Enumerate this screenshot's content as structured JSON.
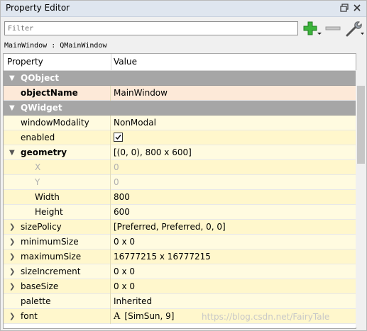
{
  "window": {
    "title": "Property Editor",
    "float_icon": "float-icon",
    "close_icon": "close-icon"
  },
  "toolbar": {
    "filter_placeholder": "Filter",
    "add_icon": "plus-icon",
    "remove_icon": "minus-icon",
    "configure_icon": "wrench-icon"
  },
  "object_label": "MainWindow : QMainWindow",
  "table": {
    "header_property": "Property",
    "header_value": "Value"
  },
  "rows": [
    {
      "type": "category",
      "name": "QObject"
    },
    {
      "type": "prop",
      "name": "objectName",
      "value": "MainWindow",
      "bold": true,
      "selected": true
    },
    {
      "type": "category",
      "name": "QWidget"
    },
    {
      "type": "prop",
      "name": "windowModality",
      "value": "NonModal"
    },
    {
      "type": "prop",
      "name": "enabled",
      "value": "",
      "checked": true
    },
    {
      "type": "prop",
      "name": "geometry",
      "value": "[(0, 0), 800 x 600]",
      "bold": true,
      "expanded": true
    },
    {
      "type": "sub",
      "name": "X",
      "value": "0",
      "dim": true
    },
    {
      "type": "sub",
      "name": "Y",
      "value": "0",
      "dim": true
    },
    {
      "type": "sub",
      "name": "Width",
      "value": "800"
    },
    {
      "type": "sub",
      "name": "Height",
      "value": "600"
    },
    {
      "type": "prop",
      "name": "sizePolicy",
      "value": "[Preferred, Preferred, 0, 0]",
      "collapsed": true
    },
    {
      "type": "prop",
      "name": "minimumSize",
      "value": "0 x 0",
      "collapsed": true
    },
    {
      "type": "prop",
      "name": "maximumSize",
      "value": "16777215 x 16777215",
      "collapsed": true
    },
    {
      "type": "prop",
      "name": "sizeIncrement",
      "value": "0 x 0",
      "collapsed": true
    },
    {
      "type": "prop",
      "name": "baseSize",
      "value": "0 x 0",
      "collapsed": true
    },
    {
      "type": "prop",
      "name": "palette",
      "value": "Inherited"
    },
    {
      "type": "prop",
      "name": "font",
      "value": "[SimSun, 9]",
      "collapsed": true,
      "font_glyph": "A"
    }
  ],
  "watermark": "https://blog.csdn.net/FairyTale"
}
